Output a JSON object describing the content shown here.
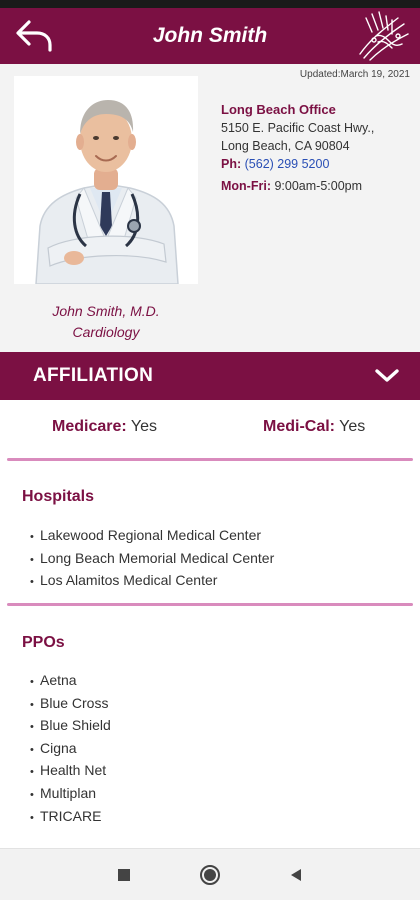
{
  "header": {
    "title": "John Smith",
    "back_icon": "back-arrow-icon",
    "logo_icon": "brand-logo-icon",
    "background_color": "#7b1043"
  },
  "profile": {
    "updated": "Updated:March 19, 2021",
    "name_line": "John Smith, M.D.",
    "specialty": "Cardiology",
    "office": {
      "name": "Long Beach Office",
      "address_line1": "5150 E. Pacific Coast Hwy.,",
      "address_line2": "Long Beach, CA 90804",
      "phone_label": "Ph:",
      "phone": "(562) 299 5200",
      "hours_label": "Mon-Fri:",
      "hours": "9:00am-5:00pm"
    }
  },
  "affiliation": {
    "title": "AFFILIATION",
    "toggle_icon": "chevron-down-icon",
    "medicare_label": "Medicare:",
    "medicare_value": "Yes",
    "medical_label": "Medi-Cal:",
    "medical_value": "Yes"
  },
  "hospitals": {
    "title": "Hospitals",
    "items": [
      "Lakewood Regional Medical Center",
      "Long Beach Memorial Medical Center",
      "Los Alamitos Medical Center"
    ]
  },
  "ppos": {
    "title": "PPOs",
    "items": [
      "Aetna",
      "Blue Cross",
      "Blue Shield",
      "Cigna",
      "Health Net",
      "Multiplan",
      "TRICARE"
    ]
  },
  "nav": {
    "recents_icon": "square-icon",
    "home_icon": "circle-icon",
    "back_icon": "triangle-back-icon"
  },
  "colors": {
    "accent": "#7b1043",
    "divider": "#d98bbd",
    "link": "#2a4fb5"
  }
}
